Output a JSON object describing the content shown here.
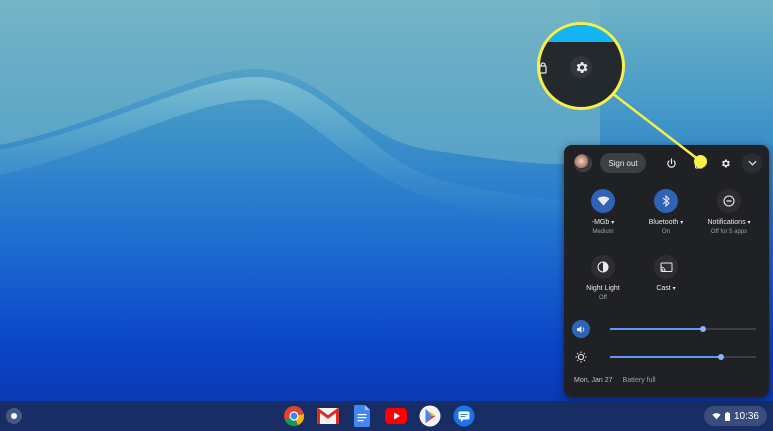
{
  "quick_settings": {
    "sign_out_label": "Sign out",
    "network": {
      "label": "-MGb",
      "sublabel": "Medium"
    },
    "bluetooth": {
      "label": "Bluetooth",
      "sublabel": "On"
    },
    "notifications": {
      "label": "Notifications",
      "sublabel": "Off for 5 apps"
    },
    "night_light": {
      "label": "Night Light",
      "sublabel": "Off"
    },
    "cast": {
      "label": "Cast"
    },
    "volume_level": 0.64,
    "brightness_level": 0.76,
    "date": "Mon, Jan 27",
    "battery_status": "Battery full"
  },
  "shelf": {
    "apps": [
      "Chrome",
      "Gmail",
      "Docs",
      "YouTube",
      "Play Store",
      "Messages"
    ],
    "clock": "10:36"
  },
  "colors": {
    "panel_bg": "#202124",
    "accent": "#2f63b6",
    "highlight": "#f4f14a"
  }
}
